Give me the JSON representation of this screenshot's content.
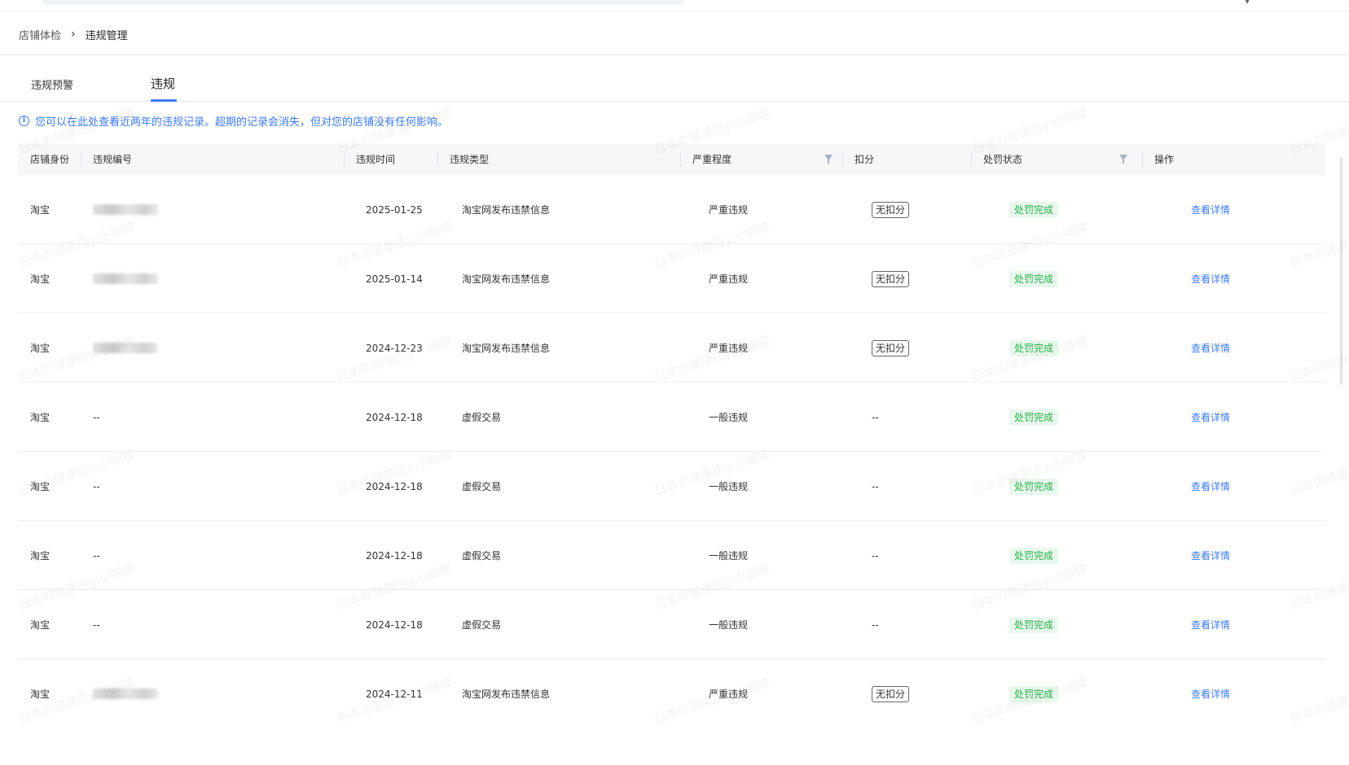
{
  "breadcrumb": {
    "parent": "店铺体检",
    "current": "违规管理"
  },
  "tabs": [
    {
      "label": "违规预警",
      "active": false
    },
    {
      "label": "违规",
      "active": true
    }
  ],
  "notice": {
    "icon": "info-icon",
    "text": "您可以在此处查看近两年的违规记录。超期的记录会消失，但对您的店铺没有任何影响。"
  },
  "table": {
    "columns": [
      "店铺身份",
      "违规编号",
      "违规时间",
      "违规类型",
      "严重程度",
      "扣分",
      "处罚状态",
      "操作"
    ],
    "filterable": [
      "严重程度",
      "处罚状态"
    ],
    "rows": [
      {
        "identity": "淘宝",
        "code": "",
        "code_blurred": true,
        "time": "2025-01-25",
        "type": "淘宝网发布违禁信息",
        "severity": "严重违规",
        "deduct": "无扣分",
        "deduct_tag": true,
        "status": "处罚完成",
        "action": "查看详情"
      },
      {
        "identity": "淘宝",
        "code": "",
        "code_blurred": true,
        "time": "2025-01-14",
        "type": "淘宝网发布违禁信息",
        "severity": "严重违规",
        "deduct": "无扣分",
        "deduct_tag": true,
        "status": "处罚完成",
        "action": "查看详情"
      },
      {
        "identity": "淘宝",
        "code": "",
        "code_blurred": true,
        "time": "2024-12-23",
        "type": "淘宝网发布违禁信息",
        "severity": "严重违规",
        "deduct": "无扣分",
        "deduct_tag": true,
        "status": "处罚完成",
        "action": "查看详情"
      },
      {
        "identity": "淘宝",
        "code": "--",
        "code_blurred": false,
        "time": "2024-12-18",
        "type": "虚假交易",
        "severity": "一般违规",
        "deduct": "--",
        "deduct_tag": false,
        "status": "处罚完成",
        "action": "查看详情"
      },
      {
        "identity": "淘宝",
        "code": "--",
        "code_blurred": false,
        "time": "2024-12-18",
        "type": "虚假交易",
        "severity": "一般违规",
        "deduct": "--",
        "deduct_tag": false,
        "status": "处罚完成",
        "action": "查看详情"
      },
      {
        "identity": "淘宝",
        "code": "--",
        "code_blurred": false,
        "time": "2024-12-18",
        "type": "虚假交易",
        "severity": "一般违规",
        "deduct": "--",
        "deduct_tag": false,
        "status": "处罚完成",
        "action": "查看详情"
      },
      {
        "identity": "淘宝",
        "code": "--",
        "code_blurred": false,
        "time": "2024-12-18",
        "type": "虚假交易",
        "severity": "一般违规",
        "deduct": "--",
        "deduct_tag": false,
        "status": "处罚完成",
        "action": "查看详情"
      },
      {
        "identity": "淘宝",
        "code": "",
        "code_blurred": true,
        "time": "2024-12-11",
        "type": "淘宝网发布违禁信息",
        "severity": "严重违规",
        "deduct": "无扣分",
        "deduct_tag": true,
        "status": "处罚完成",
        "action": "查看详情"
      }
    ]
  },
  "watermark": "日本の健康店y:小蝴蝶",
  "colors": {
    "primary": "#3d7bf7",
    "success_text": "#29b04a",
    "success_bg": "#e8f8ec",
    "header_bg": "#f6f7f9"
  }
}
